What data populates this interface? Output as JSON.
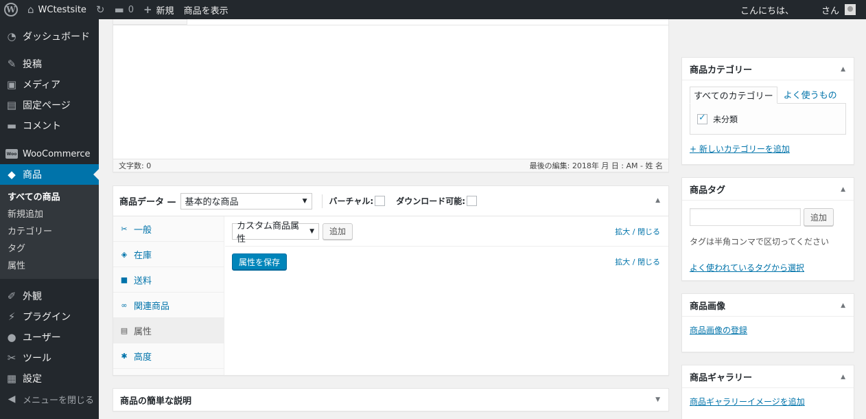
{
  "adminbar": {
    "site_name": "WCtestsite",
    "comments_count": "0",
    "new_label": "新規",
    "view_product": "商品を表示",
    "greeting": "こんにちは、",
    "user_suffix": "さん"
  },
  "sidebar": {
    "dashboard": "ダッシュボード",
    "posts": "投稿",
    "media": "メディア",
    "pages": "固定ページ",
    "comments": "コメント",
    "woocommerce": "WooCommerce",
    "woo_badge": "Woo",
    "products": "商品",
    "submenu": [
      "すべての商品",
      "新規追加",
      "カテゴリー",
      "タグ",
      "属性"
    ],
    "appearance": "外観",
    "plugins": "プラグイン",
    "users": "ユーザー",
    "tools": "ツール",
    "settings": "設定",
    "collapse": "メニューを閉じる"
  },
  "editor": {
    "word_count": "文字数: 0",
    "last_edit": "最後の編集: 2018年  月    日 :    AM - 姓 名"
  },
  "product_data": {
    "title": "商品データ —",
    "type_selected": "基本的な商品",
    "virtual_label": "バーチャル:",
    "download_label": "ダウンロード可能:",
    "tabs": [
      {
        "label": "一般",
        "icon": "wrench-icon"
      },
      {
        "label": "在庫",
        "icon": "tag-icon"
      },
      {
        "label": "送料",
        "icon": "truck-icon"
      },
      {
        "label": "関連商品",
        "icon": "link-icon"
      },
      {
        "label": "属性",
        "icon": "list-icon"
      },
      {
        "label": "高度",
        "icon": "gear-icon"
      }
    ],
    "attribute_select": "カスタム商品属性",
    "add_button": "追加",
    "expand_close": "拡大 / 閉じる",
    "save_attributes": "属性を保存"
  },
  "short_description": {
    "title": "商品の簡単な説明"
  },
  "categories": {
    "title": "商品カテゴリー",
    "tab_all": "すべてのカテゴリー",
    "tab_popular": "よく使うもの",
    "item": "未分類",
    "add_new": "+ 新しいカテゴリーを追加"
  },
  "tags": {
    "title": "商品タグ",
    "add_button": "追加",
    "help": "タグは半角コンマで区切ってください",
    "choose": "よく使われているタグから選択"
  },
  "product_image": {
    "title": "商品画像",
    "set_link": "商品画像の登録"
  },
  "gallery": {
    "title": "商品ギャラリー",
    "add_link": "商品ギャラリーイメージを追加"
  },
  "colors": {
    "admin_dark": "#23282d",
    "accent": "#0073aa",
    "primary_button": "#0085ba"
  }
}
